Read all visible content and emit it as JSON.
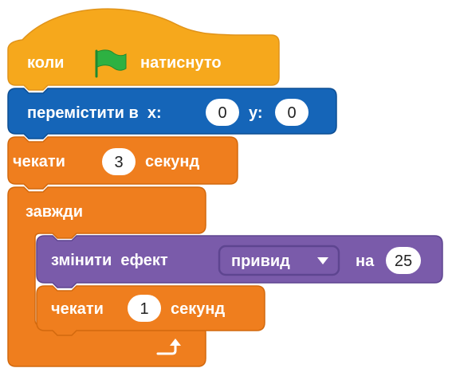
{
  "colors": {
    "events": "#F6A81C",
    "events_edge": "#E0931A",
    "motion": "#1565B8",
    "motion_edge": "#0D4E93",
    "control": "#EF7E1E",
    "control_edge": "#D2690E",
    "looks": "#7A5BAA",
    "looks_edge": "#5E4590",
    "flag": "#2DB142",
    "input_bg": "#FFFFFF"
  },
  "blocks": {
    "when_flag": {
      "label_before": "коли",
      "icon": "green-flag-icon",
      "label_after": "натиснуто"
    },
    "go_to": {
      "label": "перемістити в  х:",
      "x_value": "0",
      "y_label": "у:",
      "y_value": "0"
    },
    "wait_top": {
      "label": "чекати",
      "value": "3",
      "unit": "секунд"
    },
    "forever": {
      "label": "завжди",
      "icon": "loop-arrow-icon"
    },
    "change_effect": {
      "label": "змінити  ефект",
      "effect": "привид",
      "dropdown_icon": "dropdown-triangle-icon",
      "by_label": "на",
      "value": "25"
    },
    "wait_inner": {
      "label": "чекати",
      "value": "1",
      "unit": "секунд"
    }
  }
}
